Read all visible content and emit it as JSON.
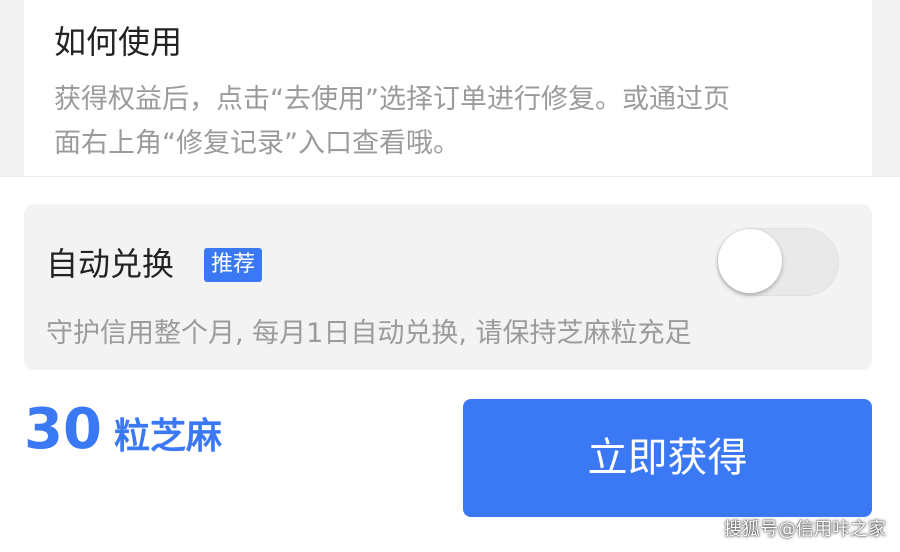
{
  "usage": {
    "title": "如何使用",
    "desc_lines": [
      "获得权益后，点击“去使用”选择订单进行修复。或通过页",
      "面右上角“修复记录”入口查看哦。"
    ]
  },
  "auto_exchange": {
    "title": "自动兑换",
    "badge": "推荐",
    "toggle_state": "off",
    "desc": "守护信用整个月, 每月1日自动兑换, 请保持芝麻粒充足"
  },
  "price": {
    "amount": "30",
    "unit": "粒芝麻"
  },
  "action": {
    "button_label": "立即获得"
  },
  "watermark": "搜狐号@信用咔之家",
  "colors": {
    "accent": "#3b78f3",
    "background": "#f3f3f4",
    "muted_text": "#9b9b9b"
  }
}
